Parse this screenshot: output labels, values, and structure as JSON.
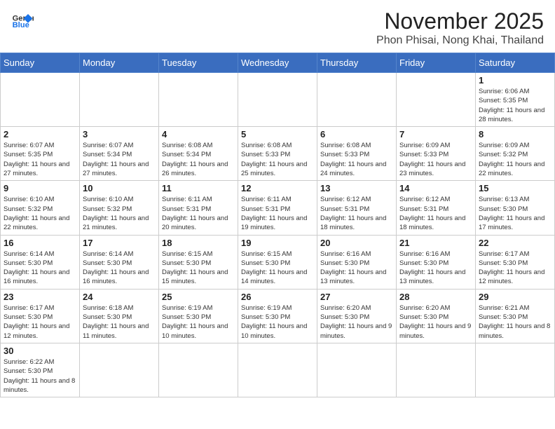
{
  "header": {
    "logo_general": "General",
    "logo_blue": "Blue",
    "month": "November 2025",
    "location": "Phon Phisai, Nong Khai, Thailand"
  },
  "weekdays": [
    "Sunday",
    "Monday",
    "Tuesday",
    "Wednesday",
    "Thursday",
    "Friday",
    "Saturday"
  ],
  "days": {
    "d1": {
      "num": "1",
      "sunrise": "6:06 AM",
      "sunset": "5:35 PM",
      "daylight": "11 hours and 28 minutes."
    },
    "d2": {
      "num": "2",
      "sunrise": "6:07 AM",
      "sunset": "5:35 PM",
      "daylight": "11 hours and 27 minutes."
    },
    "d3": {
      "num": "3",
      "sunrise": "6:07 AM",
      "sunset": "5:34 PM",
      "daylight": "11 hours and 27 minutes."
    },
    "d4": {
      "num": "4",
      "sunrise": "6:08 AM",
      "sunset": "5:34 PM",
      "daylight": "11 hours and 26 minutes."
    },
    "d5": {
      "num": "5",
      "sunrise": "6:08 AM",
      "sunset": "5:33 PM",
      "daylight": "11 hours and 25 minutes."
    },
    "d6": {
      "num": "6",
      "sunrise": "6:08 AM",
      "sunset": "5:33 PM",
      "daylight": "11 hours and 24 minutes."
    },
    "d7": {
      "num": "7",
      "sunrise": "6:09 AM",
      "sunset": "5:33 PM",
      "daylight": "11 hours and 23 minutes."
    },
    "d8": {
      "num": "8",
      "sunrise": "6:09 AM",
      "sunset": "5:32 PM",
      "daylight": "11 hours and 22 minutes."
    },
    "d9": {
      "num": "9",
      "sunrise": "6:10 AM",
      "sunset": "5:32 PM",
      "daylight": "11 hours and 22 minutes."
    },
    "d10": {
      "num": "10",
      "sunrise": "6:10 AM",
      "sunset": "5:32 PM",
      "daylight": "11 hours and 21 minutes."
    },
    "d11": {
      "num": "11",
      "sunrise": "6:11 AM",
      "sunset": "5:31 PM",
      "daylight": "11 hours and 20 minutes."
    },
    "d12": {
      "num": "12",
      "sunrise": "6:11 AM",
      "sunset": "5:31 PM",
      "daylight": "11 hours and 19 minutes."
    },
    "d13": {
      "num": "13",
      "sunrise": "6:12 AM",
      "sunset": "5:31 PM",
      "daylight": "11 hours and 18 minutes."
    },
    "d14": {
      "num": "14",
      "sunrise": "6:12 AM",
      "sunset": "5:31 PM",
      "daylight": "11 hours and 18 minutes."
    },
    "d15": {
      "num": "15",
      "sunrise": "6:13 AM",
      "sunset": "5:30 PM",
      "daylight": "11 hours and 17 minutes."
    },
    "d16": {
      "num": "16",
      "sunrise": "6:14 AM",
      "sunset": "5:30 PM",
      "daylight": "11 hours and 16 minutes."
    },
    "d17": {
      "num": "17",
      "sunrise": "6:14 AM",
      "sunset": "5:30 PM",
      "daylight": "11 hours and 16 minutes."
    },
    "d18": {
      "num": "18",
      "sunrise": "6:15 AM",
      "sunset": "5:30 PM",
      "daylight": "11 hours and 15 minutes."
    },
    "d19": {
      "num": "19",
      "sunrise": "6:15 AM",
      "sunset": "5:30 PM",
      "daylight": "11 hours and 14 minutes."
    },
    "d20": {
      "num": "20",
      "sunrise": "6:16 AM",
      "sunset": "5:30 PM",
      "daylight": "11 hours and 13 minutes."
    },
    "d21": {
      "num": "21",
      "sunrise": "6:16 AM",
      "sunset": "5:30 PM",
      "daylight": "11 hours and 13 minutes."
    },
    "d22": {
      "num": "22",
      "sunrise": "6:17 AM",
      "sunset": "5:30 PM",
      "daylight": "11 hours and 12 minutes."
    },
    "d23": {
      "num": "23",
      "sunrise": "6:17 AM",
      "sunset": "5:30 PM",
      "daylight": "11 hours and 12 minutes."
    },
    "d24": {
      "num": "24",
      "sunrise": "6:18 AM",
      "sunset": "5:30 PM",
      "daylight": "11 hours and 11 minutes."
    },
    "d25": {
      "num": "25",
      "sunrise": "6:19 AM",
      "sunset": "5:30 PM",
      "daylight": "11 hours and 10 minutes."
    },
    "d26": {
      "num": "26",
      "sunrise": "6:19 AM",
      "sunset": "5:30 PM",
      "daylight": "11 hours and 10 minutes."
    },
    "d27": {
      "num": "27",
      "sunrise": "6:20 AM",
      "sunset": "5:30 PM",
      "daylight": "11 hours and 9 minutes."
    },
    "d28": {
      "num": "28",
      "sunrise": "6:20 AM",
      "sunset": "5:30 PM",
      "daylight": "11 hours and 9 minutes."
    },
    "d29": {
      "num": "29",
      "sunrise": "6:21 AM",
      "sunset": "5:30 PM",
      "daylight": "11 hours and 8 minutes."
    },
    "d30": {
      "num": "30",
      "sunrise": "6:22 AM",
      "sunset": "5:30 PM",
      "daylight": "11 hours and 8 minutes."
    }
  }
}
